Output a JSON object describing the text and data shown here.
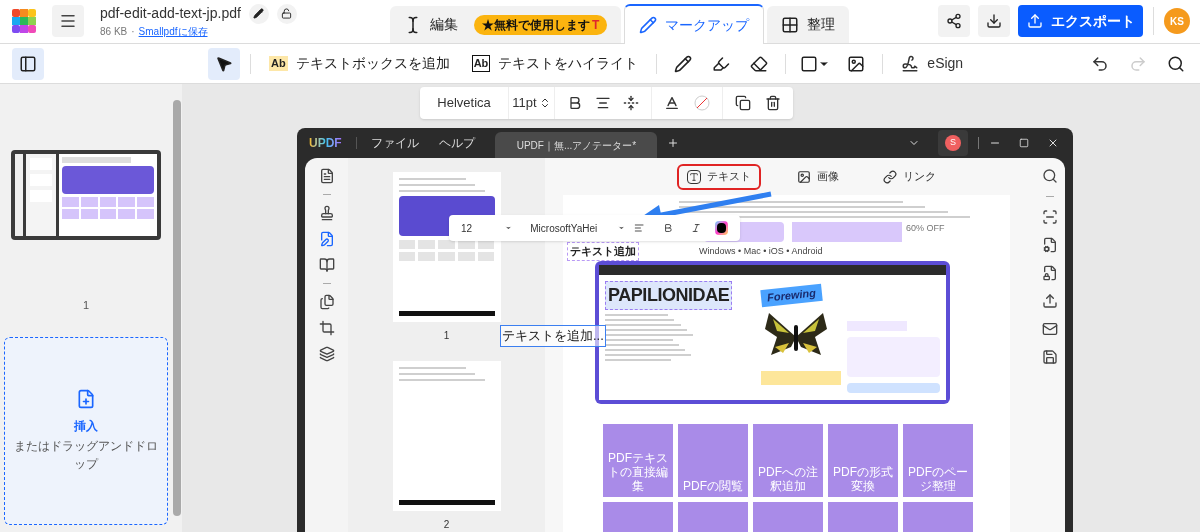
{
  "header": {
    "file_name": "pdf-edit-add-text-jp.pdf",
    "file_size": "86 KB",
    "separator": "·",
    "save_link": "Smallpdfに保存"
  },
  "mode_tabs": [
    {
      "kind": "edit",
      "label": "編集",
      "selected": false,
      "badge": "★無料で使用します",
      "badge_mark": "T"
    },
    {
      "kind": "markup",
      "label": "マークアップ",
      "selected": true
    },
    {
      "kind": "organize",
      "label": "整理",
      "selected": false
    }
  ],
  "export_button": "エクスポート",
  "avatar": "KS",
  "sidebar_toggle": {
    "on": true
  },
  "tools": [
    {
      "kind": "select",
      "selected": true
    },
    {
      "kind": "textbox",
      "badge": "Ab",
      "label": "テキストボックスを追加",
      "selected": false
    },
    {
      "kind": "highlight-text",
      "badge": "Ab",
      "label": "テキストをハイライト",
      "selected": false
    },
    {
      "kind": "pencil",
      "selected": false
    },
    {
      "kind": "highlighter",
      "selected": false
    },
    {
      "kind": "eraser",
      "selected": false
    },
    {
      "kind": "shape",
      "selected": false
    },
    {
      "kind": "image",
      "selected": false
    },
    {
      "kind": "esign",
      "label": "eSign",
      "selected": false
    }
  ],
  "undo": {
    "disabled": false
  },
  "redo": {
    "disabled": true
  },
  "format_bar": {
    "font": "Helvetica",
    "size": "11pt"
  },
  "pages": [
    {
      "label": "1",
      "selected": false
    }
  ],
  "insert": {
    "title": "挿入",
    "hint": "またはドラッグアンドドロップ"
  },
  "text_box": {
    "value": "テキストを追加..."
  },
  "embedded": {
    "logo": "UPDF",
    "menus": [
      "ファイル",
      "ヘルプ"
    ],
    "tab_title": "UPDF｜無...アノテーター*",
    "user_initial": "S",
    "thumbnails": [
      {
        "label": "1"
      },
      {
        "label": "2"
      }
    ],
    "insert_tools": [
      {
        "kind": "text",
        "label": "テキスト",
        "selected": true
      },
      {
        "kind": "image",
        "label": "画像",
        "selected": false
      },
      {
        "kind": "link",
        "label": "リンク",
        "selected": false
      }
    ],
    "font_bar": {
      "size": "12",
      "font": "MicrosoftYaHei"
    },
    "added_text": "テキスト追加",
    "discount": "60% OFF",
    "platforms": "Windows • Mac • iOS • Android",
    "hero": {
      "title": "PAPILIONIDAE",
      "tag": "Forewing"
    },
    "features": [
      "PDFテキストの直接編集",
      "PDFの閲覧",
      "PDFへの注釈追加",
      "PDFの形式変換",
      "PDFのページ整理"
    ]
  }
}
